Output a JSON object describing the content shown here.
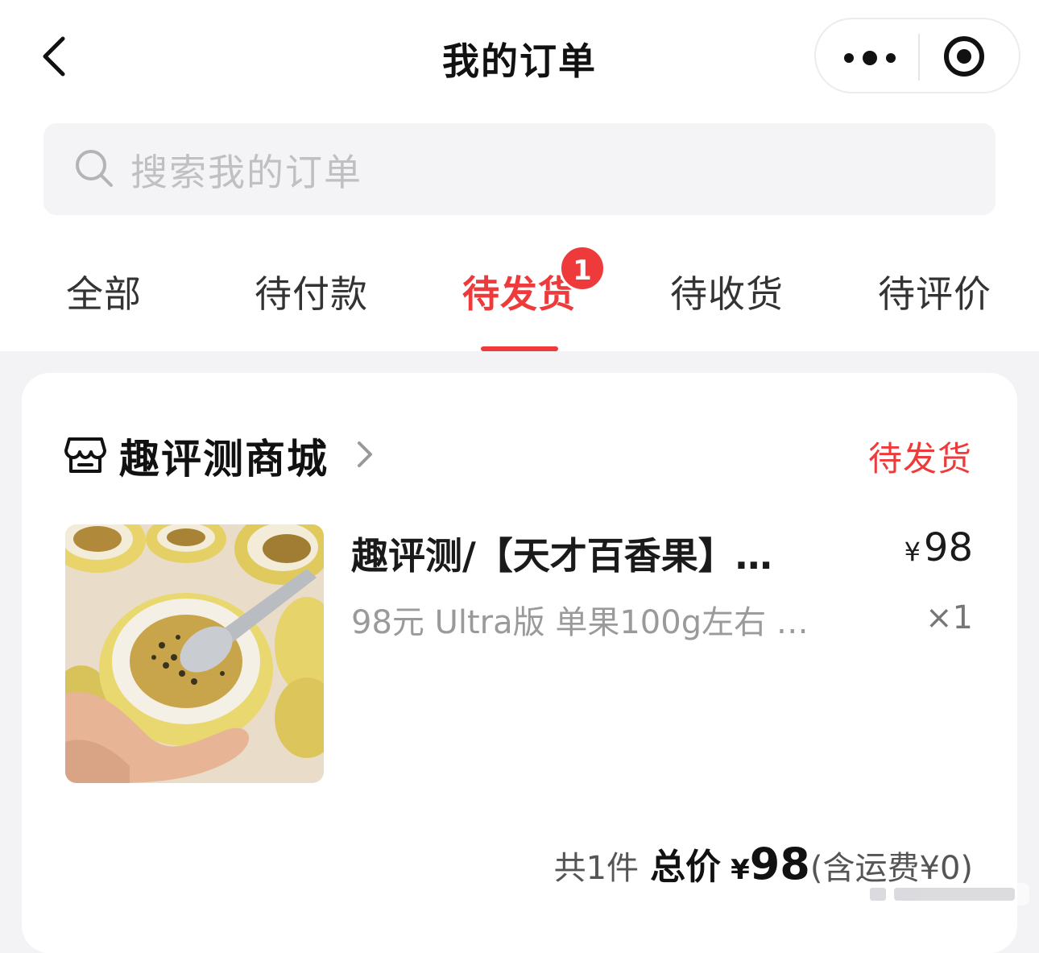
{
  "nav": {
    "title": "我的订单"
  },
  "search": {
    "placeholder": "搜索我的订单"
  },
  "tabs": [
    {
      "label": "全部"
    },
    {
      "label": "待付款"
    },
    {
      "label": "待发货",
      "active": true,
      "badge": "1"
    },
    {
      "label": "待收货"
    },
    {
      "label": "待评价"
    }
  ],
  "order": {
    "shop_name": "趣评测商城",
    "status": "待发货",
    "product": {
      "title": "趣评测/【天才百香果】…",
      "spec": "98元 Ultra版 单果100g左右 …",
      "currency": "¥",
      "price": "98",
      "qty": "×1"
    },
    "summary": {
      "count_text": "共1件",
      "total_label": "总价",
      "currency": "¥",
      "total": "98",
      "shipping_note": "(含运费¥0)"
    }
  },
  "colors": {
    "accent": "#ee3a3a",
    "page_bg": "#f3f3f5"
  }
}
